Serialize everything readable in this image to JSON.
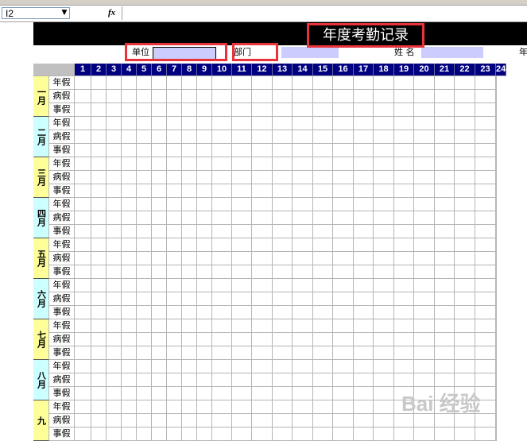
{
  "formula_bar": {
    "cell_ref": "I2",
    "fx_label": "fx",
    "formula": ""
  },
  "sheet": {
    "title": "年度考勤记录",
    "fields": {
      "unit_label": "单位",
      "dept_label": "部门",
      "name_label": "姓 名",
      "year_label": "年"
    },
    "days": [
      "1",
      "2",
      "3",
      "4",
      "5",
      "6",
      "7",
      "8",
      "9",
      "10",
      "11",
      "12",
      "13",
      "14",
      "15",
      "16",
      "17",
      "18",
      "19",
      "20",
      "21",
      "22",
      "23",
      "24"
    ],
    "leave_types": [
      "年假",
      "病假",
      "事假"
    ],
    "months": [
      "一月",
      "二月",
      "三月",
      "四月",
      "五月",
      "六月",
      "七月",
      "八月",
      "九"
    ]
  },
  "colors": {
    "header_black": "#000000",
    "day_header_bg": "#000080",
    "highlight_red": "#e8333b",
    "input_lavender": "#ccccff",
    "month_yellow": "#ffff99",
    "month_cyan": "#ccffff"
  },
  "watermark": "Bai 经验"
}
